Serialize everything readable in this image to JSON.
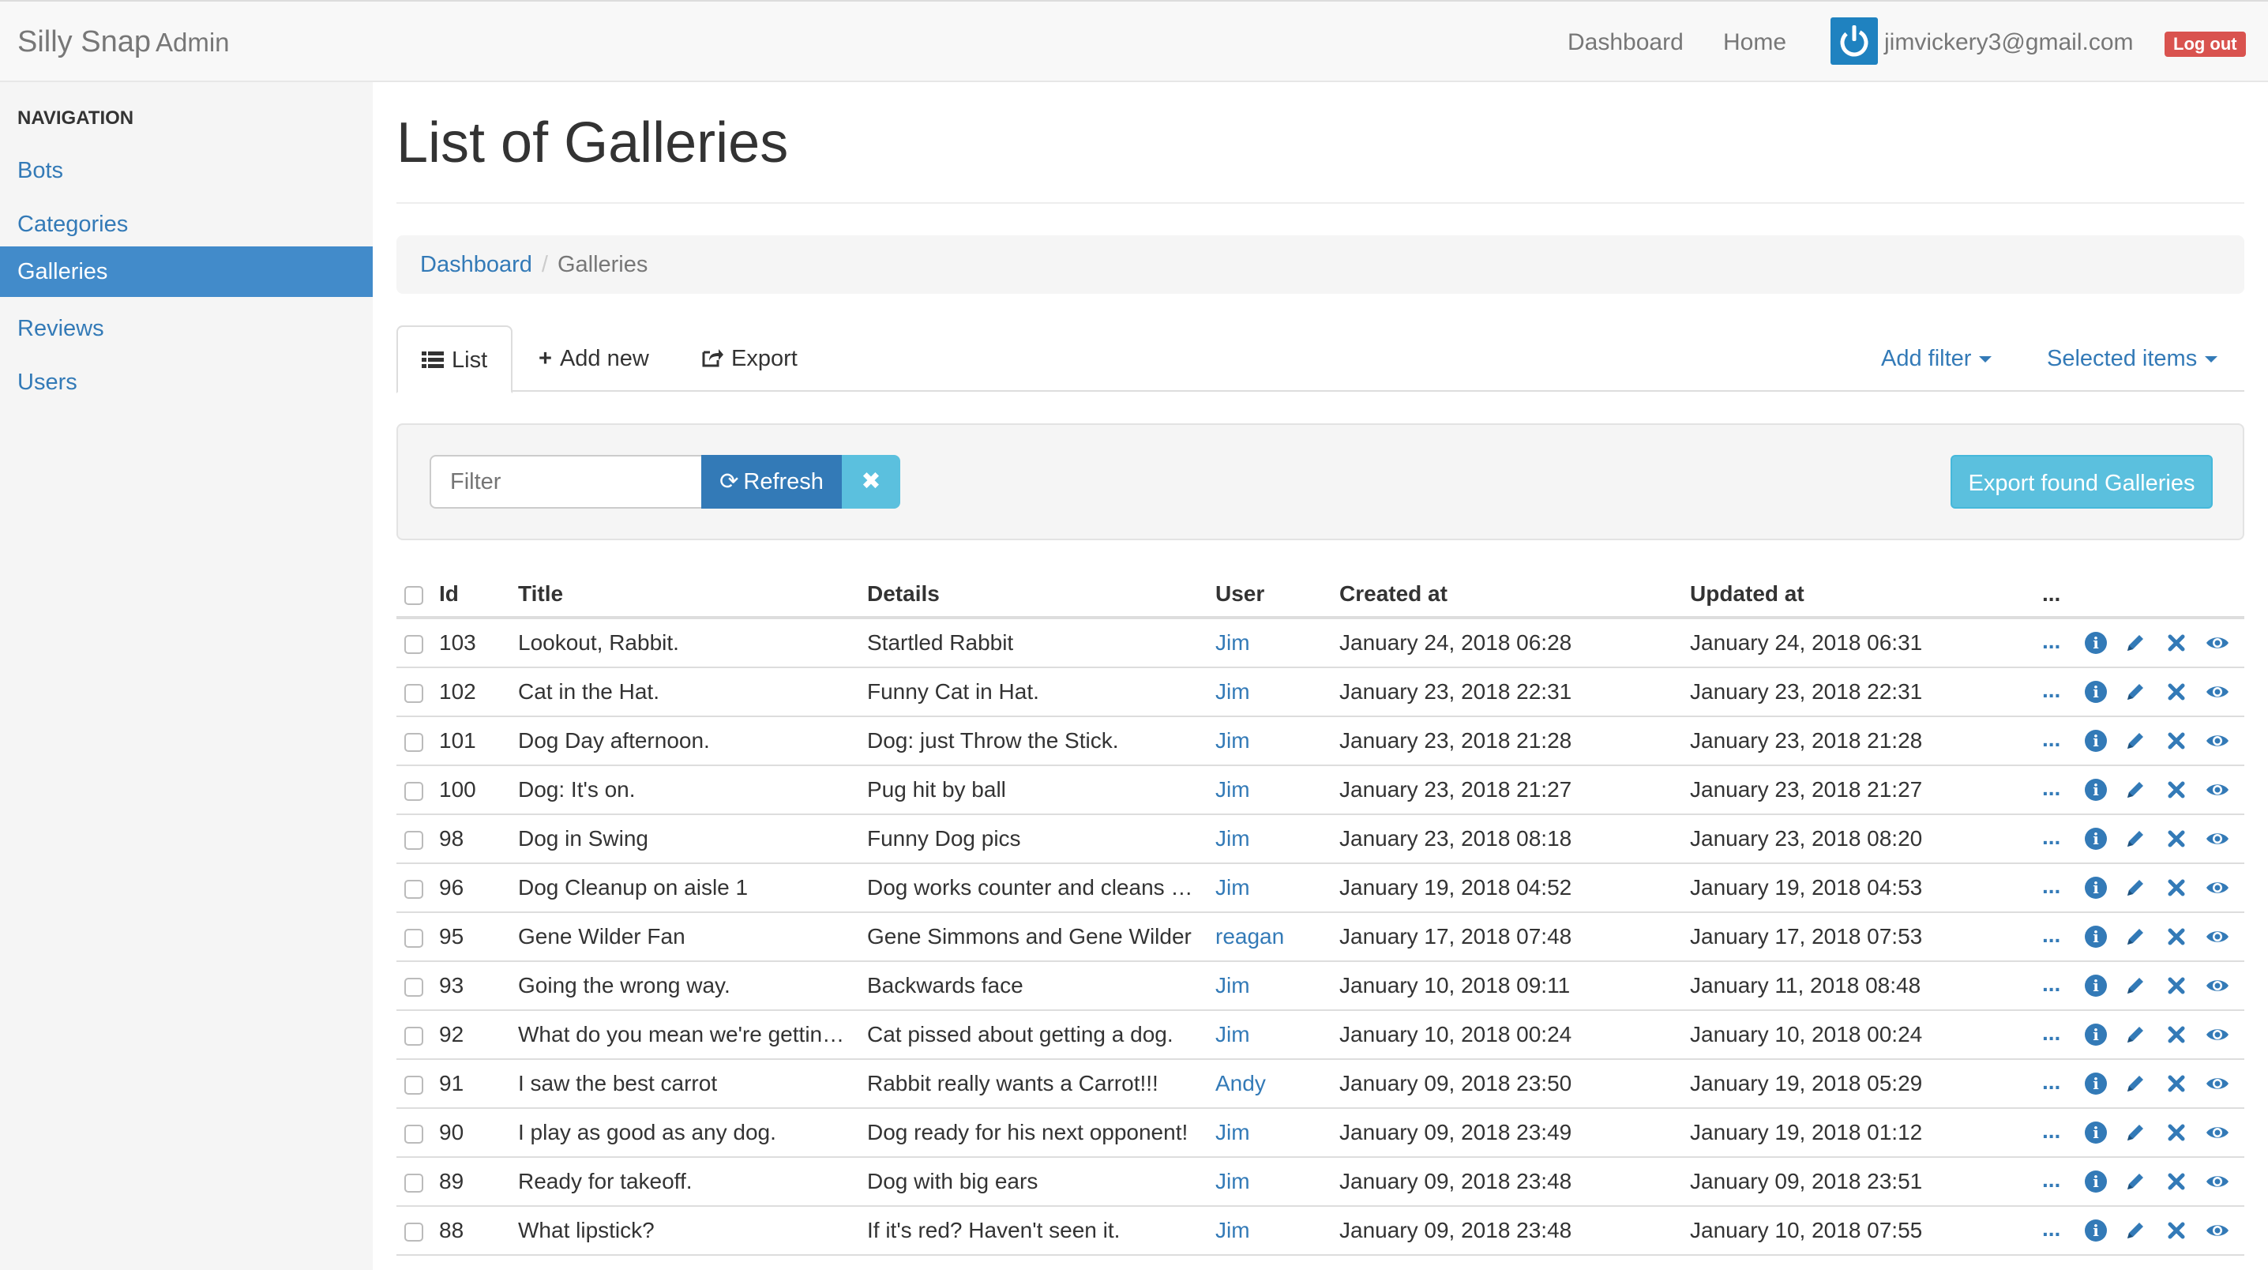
{
  "navbar": {
    "brand": "Silly Snap",
    "brand_sub": "Admin",
    "links": [
      "Dashboard",
      "Home"
    ],
    "user_email": "jimvickery3@gmail.com",
    "logout_label": "Log out"
  },
  "sidebar": {
    "header": "NAVIGATION",
    "items": [
      {
        "label": "Bots"
      },
      {
        "label": "Categories"
      },
      {
        "label": "Galleries"
      },
      {
        "label": "Reviews"
      },
      {
        "label": "Users"
      }
    ],
    "active": "Galleries"
  },
  "page": {
    "title": "List of Galleries",
    "breadcrumb": [
      "Dashboard",
      "Galleries"
    ]
  },
  "tabs": {
    "list": "List",
    "add_new": "Add new",
    "export": "Export",
    "add_filter": "Add filter",
    "selected_items": "Selected items"
  },
  "filter": {
    "placeholder": "Filter",
    "refresh_label": "Refresh",
    "export_found_label": "Export found Galleries"
  },
  "table": {
    "columns": [
      "Id",
      "Title",
      "Details",
      "User",
      "Created at",
      "Updated at",
      "..."
    ],
    "rows": [
      {
        "id": "103",
        "title": "Lookout, Rabbit.",
        "details": "Startled Rabbit",
        "user": "Jim",
        "created": "January 24, 2018 06:28",
        "updated": "January 24, 2018 06:31"
      },
      {
        "id": "102",
        "title": "Cat in the Hat.",
        "details": "Funny Cat in Hat.",
        "user": "Jim",
        "created": "January 23, 2018 22:31",
        "updated": "January 23, 2018 22:31"
      },
      {
        "id": "101",
        "title": "Dog Day afternoon.",
        "details": "Dog: just Throw the Stick.",
        "user": "Jim",
        "created": "January 23, 2018 21:28",
        "updated": "January 23, 2018 21:28"
      },
      {
        "id": "100",
        "title": "Dog: It's on.",
        "details": "Pug hit by ball",
        "user": "Jim",
        "created": "January 23, 2018 21:27",
        "updated": "January 23, 2018 21:27"
      },
      {
        "id": "98",
        "title": "Dog in Swing",
        "details": "Funny Dog pics",
        "user": "Jim",
        "created": "January 23, 2018 08:18",
        "updated": "January 23, 2018 08:20"
      },
      {
        "id": "96",
        "title": "Dog Cleanup on aisle 1",
        "details": "Dog works counter and cleans …",
        "user": "Jim",
        "created": "January 19, 2018 04:52",
        "updated": "January 19, 2018 04:53"
      },
      {
        "id": "95",
        "title": "Gene Wilder Fan",
        "details": "Gene Simmons and Gene Wilder",
        "user": "reagan",
        "created": "January 17, 2018 07:48",
        "updated": "January 17, 2018 07:53"
      },
      {
        "id": "93",
        "title": "Going the wrong way.",
        "details": "Backwards face",
        "user": "Jim",
        "created": "January 10, 2018 09:11",
        "updated": "January 11, 2018 08:48"
      },
      {
        "id": "92",
        "title": "What do you mean we're gettin…",
        "details": "Cat pissed about getting a dog.",
        "user": "Jim",
        "created": "January 10, 2018 00:24",
        "updated": "January 10, 2018 00:24"
      },
      {
        "id": "91",
        "title": "I saw the best carrot",
        "details": "Rabbit really wants a Carrot!!!",
        "user": "Andy",
        "created": "January 09, 2018 23:50",
        "updated": "January 19, 2018 05:29"
      },
      {
        "id": "90",
        "title": "I play as good as any dog.",
        "details": "Dog ready for his next opponent!",
        "user": "Jim",
        "created": "January 09, 2018 23:49",
        "updated": "January 19, 2018 01:12"
      },
      {
        "id": "89",
        "title": "Ready for takeoff.",
        "details": "Dog with big ears",
        "user": "Jim",
        "created": "January 09, 2018 23:48",
        "updated": "January 09, 2018 23:51"
      },
      {
        "id": "88",
        "title": "What lipstick?",
        "details": "If it's red? Haven't seen it.",
        "user": "Jim",
        "created": "January 09, 2018 23:48",
        "updated": "January 10, 2018 07:55"
      }
    ],
    "row_action_more": "...",
    "row_action_icons": [
      "info-icon",
      "pencil-icon",
      "delete-icon",
      "eye-icon"
    ]
  },
  "colors": {
    "link": "#337ab7",
    "active_sidebar": "#428bca",
    "danger": "#d9534f",
    "info": "#5bc0de",
    "primary": "#337ab7"
  }
}
